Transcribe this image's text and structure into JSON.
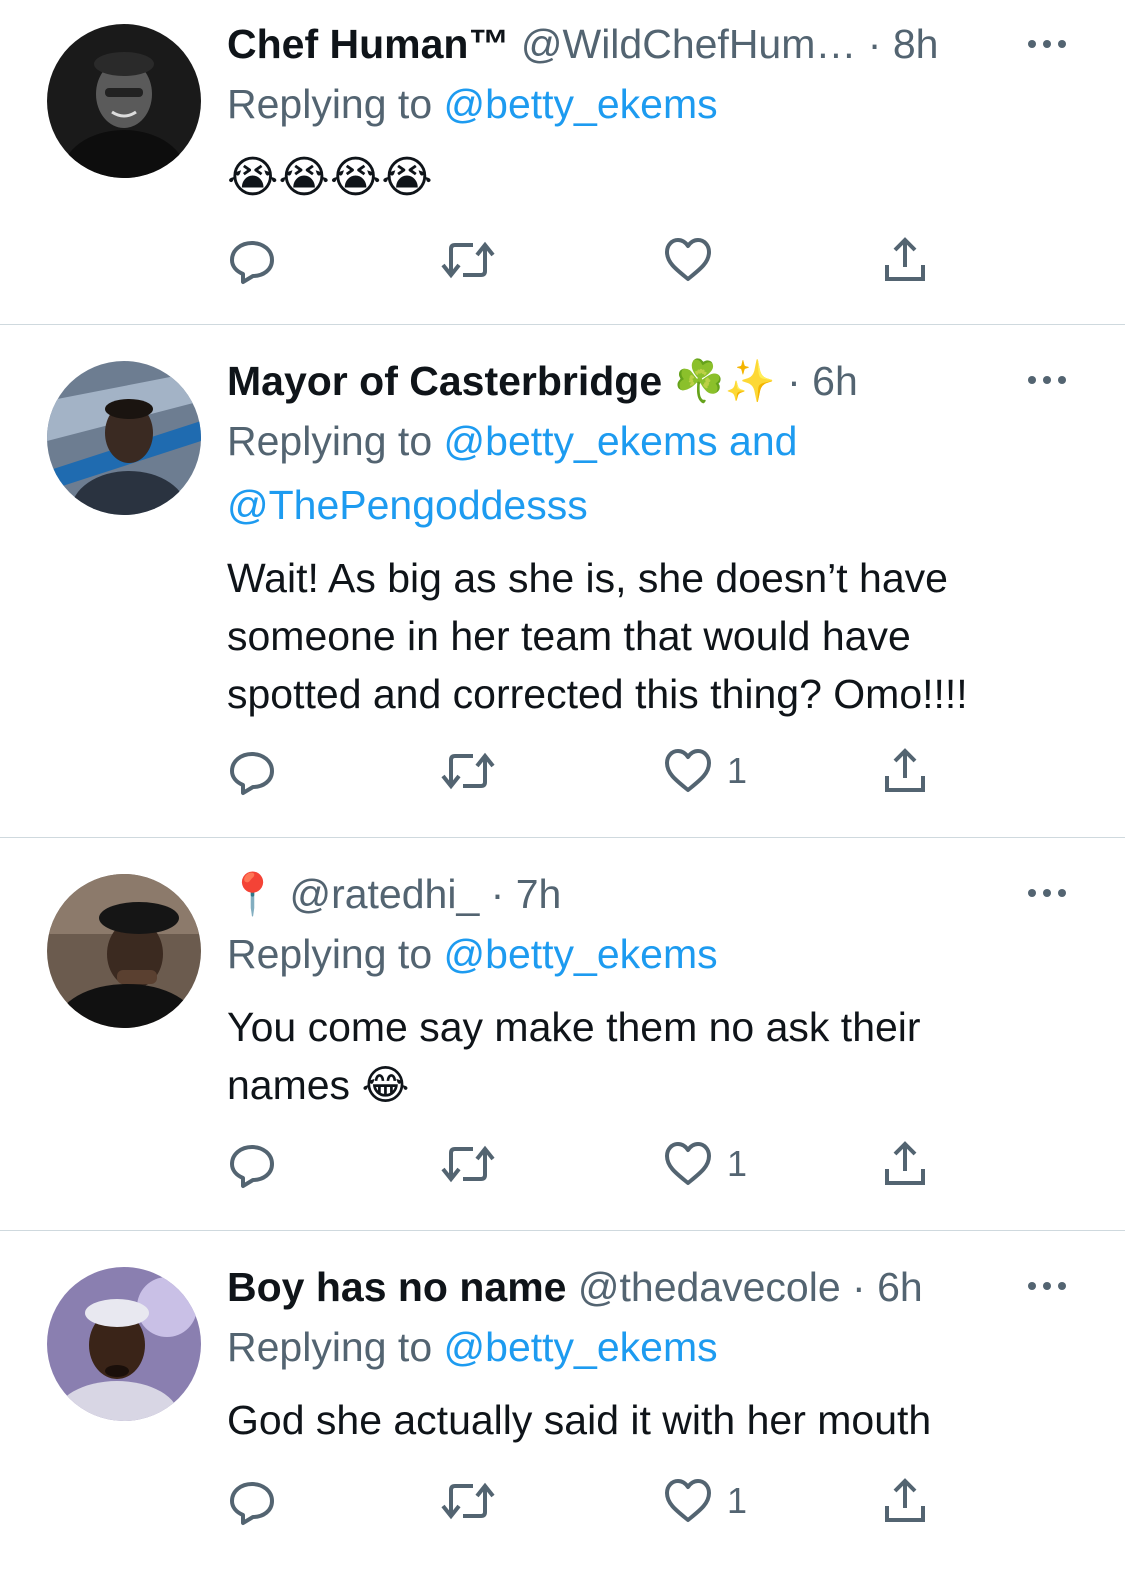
{
  "colors": {
    "link": "#1d9bf0",
    "secondary": "#536471",
    "text": "#0f1419",
    "divider": "#cfd9de"
  },
  "tweets": [
    {
      "display_name": "Chef Human™",
      "handle": "@WildChefHum…",
      "separator": "·",
      "time": "8h",
      "replying_prefix": "Replying to",
      "replying_to": "@betty_ekems",
      "replying_extra": "",
      "body": "😭😭😭😭",
      "like_count": "",
      "icons": [
        "reply-icon",
        "retweet-icon",
        "like-icon",
        "share-icon",
        "more-icon"
      ]
    },
    {
      "display_name": "Mayor of Casterbridge",
      "name_emoji": "☘️✨",
      "handle": "",
      "separator": "·",
      "time": "6h",
      "replying_prefix": "Replying to",
      "replying_to": "@betty_ekems",
      "replying_and": "and",
      "replying_extra": "@ThePengoddesss",
      "body_lines": [
        "Wait! As big as she is, she doesn’t have",
        "someone in her team that would have",
        "spotted and corrected this thing? Omo!!!!"
      ],
      "like_count": "1"
    },
    {
      "display_name": "📍",
      "handle": "@ratedhi_",
      "separator": "·",
      "time": "7h",
      "replying_prefix": "Replying to",
      "replying_to": "@betty_ekems",
      "body_lines": [
        "You come say make them no ask their",
        "names 😂"
      ],
      "like_count": "1"
    },
    {
      "display_name": "Boy has no name",
      "handle": "@thedavecole",
      "separator": "·",
      "time": "6h",
      "replying_prefix": "Replying to",
      "replying_to": "@betty_ekems",
      "body_lines": [
        "God she actually said it with her mouth"
      ],
      "like_count": "1"
    }
  ]
}
